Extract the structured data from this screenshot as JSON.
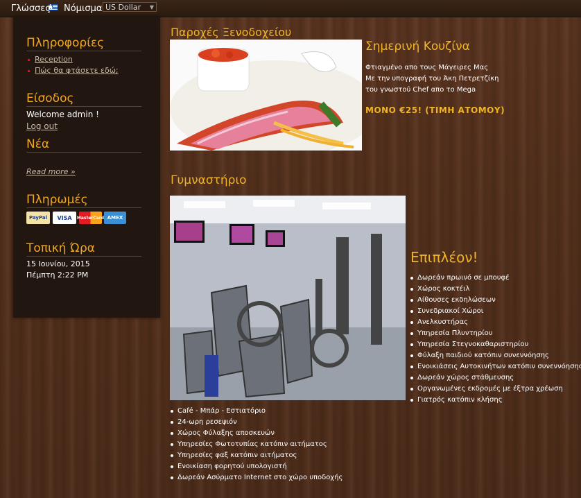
{
  "topbar": {
    "languages_label": "Γλώσσες",
    "currency_label": "Νόμισμα",
    "currency_selected": "US Dollar"
  },
  "sidebar": {
    "info_title": "Πληροφορίες",
    "info_links": [
      "Reception",
      "Πώς θα φτάσετε εδώ;"
    ],
    "login_title": "Είσοδος",
    "welcome": "Welcome admin !",
    "logout": "Log out",
    "news_title": "Νέα",
    "read_more": "Read more »",
    "payments_title": "Πληρωμές",
    "payments": [
      "PayPal",
      "VISA",
      "MasterCard",
      "AMEX"
    ],
    "time_title": "Τοπική Ώρα",
    "date": "15 Ιουνίου, 2015",
    "day_time": "Πέμπτη 2:22 PM"
  },
  "main": {
    "hotel_title": "Παροχές Ξενοδοχείου",
    "kitchen_title": "Σημερινή Κουζίνα",
    "kitchen_lines": [
      "Φτιαγμένο απο τους Μάγειρες Μας",
      "Με την υπογραφή του Άκη Πετρετζίκη",
      "του γνωστού Chef απο το Mega"
    ],
    "kitchen_price": "ΜΟΝΟ €25! (ΤΙΜΗ ΑΤΟΜΟΥ)",
    "gym_title": "Γυμναστήριο",
    "extra_title": "Επιπλέον!",
    "extra_list": [
      "Δωρεάν πρωινό σε μπουφέ",
      "Χώρος κοκτέιλ",
      "Αίθουσες εκδηλώσεων",
      "Συνεδριακοί Χώροι",
      "Ανελκυστήρας",
      "Υπηρεσία Πλυντηρίου",
      "Υπηρεσία Στεγνοκαθαριστηρίου",
      "Φύλαξη παιδιού κατόπιν συνεννόησης",
      "Ενοικιάσεις Αυτοκινήτων κατόπιν συνεννόησης",
      "Δωρεάν χώρος στάθμευσης",
      "Οργανωμένες εκδρομές με έξτρα χρέωση",
      "Γιατρός κατόπιν κλήσης"
    ],
    "bottom_list": [
      "Café - Μπάρ - Εστιατόριο",
      "24-ωρη ρεσεψιόν",
      "Χώρος Φύλαξης αποσκευών",
      "Υπηρεσίες Φωτοτυπίας κατόπιν αιτήματος",
      "Υπηρεσίες φαξ κατόπιν αιτήματος",
      "Ενοικίαση φορητού υπολογιστή",
      "Δωρεάν Ασύρματο Internet στο χώρο υποδοχής"
    ]
  }
}
